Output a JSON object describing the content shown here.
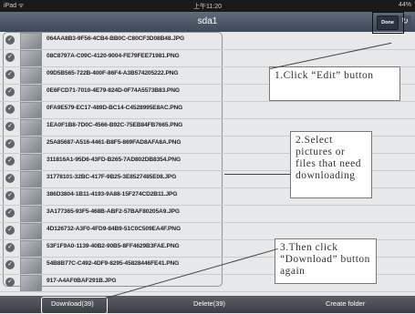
{
  "status_bar": {
    "device": "iPad ᯤ",
    "time": "上午11:20",
    "battery": "44%"
  },
  "nav": {
    "title": "sda1",
    "done_label": "Done",
    "refresh_icon": "refresh-icon"
  },
  "files": [
    "064AA8B3-9F56-4CB4-BB0C-C80CF3D08B48.JPG",
    "08C8797A-C09C-4120-9004-FE79FEE71981.PNG",
    "09D5B565-722B-400F-86F4-A3B574205222.PNG",
    "0E6FCD71-7010-4E79-824D-0F74A5573B83.PNG",
    "0FA9E579-EC17-489D-BC14-C4528995E8AC.PNG",
    "1EA0F1B8-7D0C-4566-B92C-75EB84FB7665.PNG",
    "25A85687-A516-4461-B8F5-869FAD8AFA8A.PNG",
    "311816A1-95D6-43FD-B265-7AD802DB8354.PNG",
    "31778101-32BC-417F-9B25-3E8527485E08.JPG",
    "386D3804-1B11-4193-9A88-15F274CD2B11.JPG",
    "3A177365-93F5-468B-ABF2-57BAF80205A9.JPG",
    "4D126732-A3F0-4FD9-84B9-51C0C509EA4F.PNG",
    "53F1F9A0-1139-40B2-90B5-8FF4629B3FAE.PNG",
    "54B8B77C-C492-4DF9-8295-45828446FE41.PNG",
    "917-A4AF0BAF291B.JPG"
  ],
  "bottom_bar": {
    "download": "Download(39)",
    "delete": "Delete(39)",
    "create_folder": "Create folder"
  },
  "annotations": {
    "step1": "1.Click “Edit” button",
    "step2": "2.Select pictures or files that need downloading",
    "step3": "3.Then click “Download” button again"
  }
}
